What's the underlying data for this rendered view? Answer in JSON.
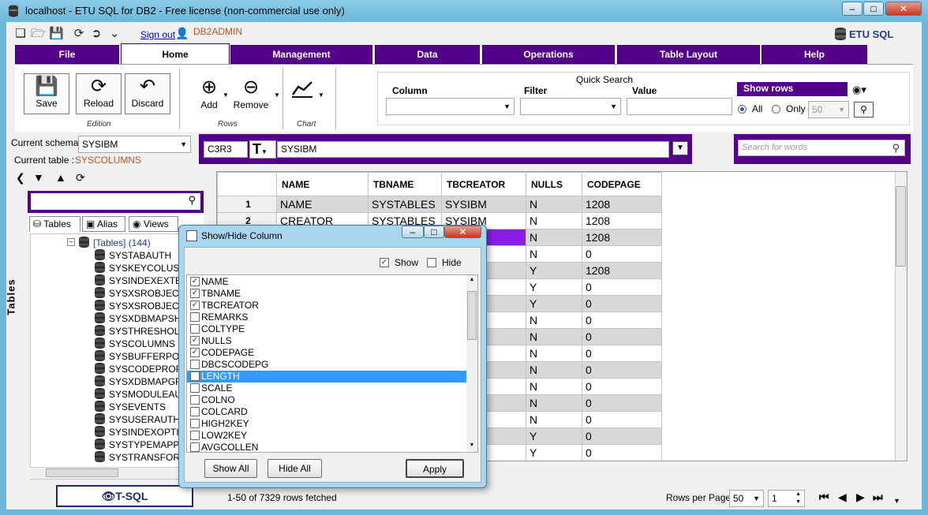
{
  "window": {
    "title": "localhost - ETU SQL for DB2 - Free license (non-commercial use only)",
    "brand": "ETU SQL"
  },
  "toolbar": {
    "signout_label": "Sign out",
    "username": "DB2ADMIN"
  },
  "tabs": [
    "File",
    "Home",
    "Management",
    "Data",
    "Operations",
    "Table Layout",
    "Help"
  ],
  "ribbon": {
    "save": "Save",
    "reload": "Reload",
    "discard": "Discard",
    "edition": "Edition",
    "add": "Add",
    "remove": "Remove",
    "rows": "Rows",
    "chart": "Chart"
  },
  "quick_search": {
    "title": "Quick Search",
    "column_label": "Column",
    "filter_label": "Filter",
    "value_label": "Value",
    "show_rows": "Show rows",
    "all_label": "All",
    "only_label": "Only",
    "only_value": "50"
  },
  "schema": {
    "current_schema_label": "Current schema :",
    "current_schema_value": "SYSIBM",
    "current_table_label": "Current table :",
    "current_table_value": "SYSCOLUMNS"
  },
  "left_tabs": [
    "Tables",
    "Alias",
    "Views"
  ],
  "side_label": "Tables",
  "tree": {
    "root": "[Tables] (144)",
    "items": [
      "SYSTABAUTH",
      "SYSKEYCOLUSE",
      "SYSINDEXEXTEN",
      "SYSXSROBJECTC",
      "SYSXSROBJECTH",
      "SYSXDBMAPSHR",
      "SYSTHRESHOLD",
      "SYSCOLUMNS",
      "SYSBUFFERPOO",
      "SYSCODEPROPE",
      "SYSXDBMAPGRA",
      "SYSMODULEAUT",
      "SYSEVENTS",
      "SYSUSERAUTH",
      "SYSINDEXOPTIO",
      "SYSTYPEMAPPIN",
      "SYSTRANSFORM"
    ]
  },
  "tsql_label": "T-SQL",
  "editor": {
    "cellref": "C3R3",
    "type_glyph": "T",
    "value": "SYSIBM",
    "search_placeholder": "Search for words"
  },
  "grid": {
    "columns": [
      "NAME",
      "TBNAME",
      "TBCREATOR",
      "NULLS",
      "CODEPAGE"
    ],
    "rows": [
      {
        "n": "1",
        "name": "NAME",
        "tbname": "SYSTABLES",
        "tbcreator": "SYSIBM",
        "nulls": "N",
        "codepage": "1208"
      },
      {
        "n": "2",
        "name": "CREATOR",
        "tbname": "SYSTABLES",
        "tbcreator": "SYSIBM",
        "nulls": "N",
        "codepage": "1208"
      },
      {
        "n": "",
        "name": "",
        "tbname": "",
        "tbcreator": "",
        "nulls": "N",
        "codepage": "1208"
      },
      {
        "n": "",
        "name": "",
        "tbname": "",
        "tbcreator": "",
        "nulls": "N",
        "codepage": "0"
      },
      {
        "n": "",
        "name": "",
        "tbname": "",
        "tbcreator": "",
        "nulls": "Y",
        "codepage": "1208"
      },
      {
        "n": "",
        "name": "",
        "tbname": "",
        "tbcreator": "",
        "nulls": "Y",
        "codepage": "0"
      },
      {
        "n": "",
        "name": "",
        "tbname": "",
        "tbcreator": "",
        "nulls": "Y",
        "codepage": "0"
      },
      {
        "n": "",
        "name": "",
        "tbname": "",
        "tbcreator": "",
        "nulls": "N",
        "codepage": "0"
      },
      {
        "n": "",
        "name": "",
        "tbname": "",
        "tbcreator": "",
        "nulls": "N",
        "codepage": "0"
      },
      {
        "n": "",
        "name": "",
        "tbname": "",
        "tbcreator": "",
        "nulls": "N",
        "codepage": "0"
      },
      {
        "n": "",
        "name": "",
        "tbname": "",
        "tbcreator": "",
        "nulls": "N",
        "codepage": "0"
      },
      {
        "n": "",
        "name": "",
        "tbname": "",
        "tbcreator": "",
        "nulls": "N",
        "codepage": "0"
      },
      {
        "n": "",
        "name": "",
        "tbname": "",
        "tbcreator": "",
        "nulls": "N",
        "codepage": "0"
      },
      {
        "n": "",
        "name": "",
        "tbname": "",
        "tbcreator": "",
        "nulls": "N",
        "codepage": "0"
      },
      {
        "n": "",
        "name": "",
        "tbname": "",
        "tbcreator": "",
        "nulls": "Y",
        "codepage": "0"
      },
      {
        "n": "",
        "name": "",
        "tbname": "",
        "tbcreator": "",
        "nulls": "Y",
        "codepage": "0"
      }
    ]
  },
  "footer": {
    "fetched": "1-50 of 7329 rows fetched",
    "rows_per_page_label": "Rows per Page:",
    "rows_per_page_value": "50",
    "page_value": "1"
  },
  "dialog": {
    "title": "Show/Hide Column",
    "show_label": "Show",
    "hide_label": "Hide",
    "columns": [
      {
        "name": "NAME",
        "checked": true
      },
      {
        "name": "TBNAME",
        "checked": true
      },
      {
        "name": "TBCREATOR",
        "checked": true
      },
      {
        "name": "REMARKS",
        "checked": false
      },
      {
        "name": "COLTYPE",
        "checked": false
      },
      {
        "name": "NULLS",
        "checked": true
      },
      {
        "name": "CODEPAGE",
        "checked": true
      },
      {
        "name": "DBCSCODEPG",
        "checked": false
      },
      {
        "name": "LENGTH",
        "checked": false,
        "highlighted": true
      },
      {
        "name": "SCALE",
        "checked": false
      },
      {
        "name": "COLNO",
        "checked": false
      },
      {
        "name": "COLCARD",
        "checked": false
      },
      {
        "name": "HIGH2KEY",
        "checked": false
      },
      {
        "name": "LOW2KEY",
        "checked": false
      },
      {
        "name": "AVGCOLLEN",
        "checked": false
      }
    ],
    "show_all": "Show All",
    "hide_all": "Hide All",
    "apply": "Apply"
  },
  "colors": {
    "accent": "#55008a",
    "selection": "#3399ff",
    "selected_cell": "#8a1ee8",
    "username": "#c8501e"
  }
}
